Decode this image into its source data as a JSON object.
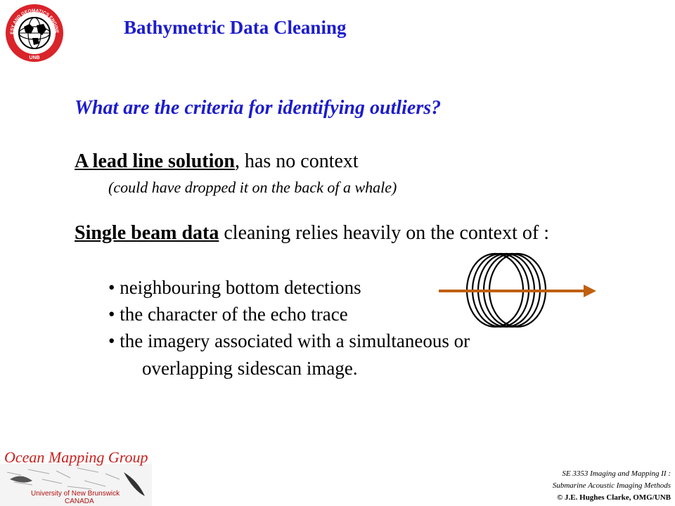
{
  "header": {
    "title": "Bathymetric Data Cleaning",
    "logo_text": "GEODESY AND GEOMATICS ENGINEERING",
    "logo_bottom": "UNB"
  },
  "body": {
    "question": "What are the criteria for identifying outliers?",
    "lead_line": {
      "term": "A lead line solution",
      "rest": ", has no context",
      "note": "(could have dropped it on the back of a whale)"
    },
    "single_beam": {
      "term": "Single beam data",
      "rest": " cleaning relies heavily on the context of :"
    },
    "bullets": [
      "• neighbouring bottom detections",
      "• the character of the echo trace",
      "• the imagery associated with a simultaneous or"
    ],
    "bullet_continuation": "overlapping sidescan image."
  },
  "footer": {
    "group_name": "Ocean Mapping Group",
    "university": "University of New Brunswick",
    "country": "CANADA",
    "course": "SE 3353 Imaging and Mapping II :",
    "course_subtitle": "Submarine Acoustic Imaging Methods",
    "copyright": "© J.E. Hughes Clarke, OMG/UNB"
  },
  "colors": {
    "title_blue": "#1c1ccc",
    "arrow_orange": "#c06010",
    "omg_red": "#c8201c"
  }
}
